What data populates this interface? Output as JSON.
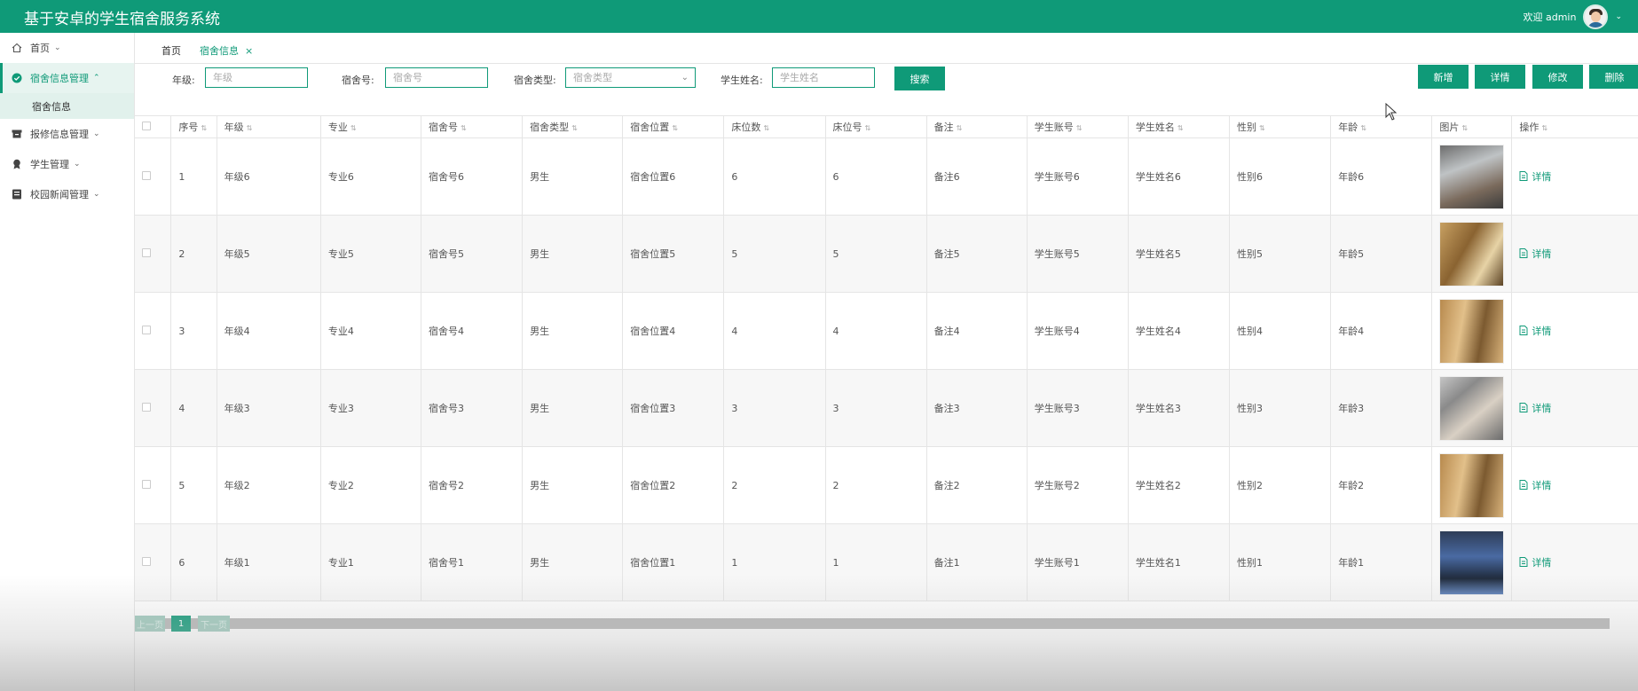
{
  "header": {
    "app_title": "基于安卓的学生宿舍服务系统",
    "welcome": "欢迎 admin",
    "avatar_icon": "user-avatar-icon"
  },
  "sidebar": {
    "items": [
      {
        "label": "首页",
        "icon": "home-icon"
      },
      {
        "label": "宿舍信息管理",
        "icon": "check-circle-icon",
        "active": true
      },
      {
        "label": "报修信息管理",
        "icon": "archive-box-icon"
      },
      {
        "label": "学生管理",
        "icon": "badge-icon"
      },
      {
        "label": "校园新闻管理",
        "icon": "news-icon"
      }
    ],
    "sub_item": "宿舍信息"
  },
  "tabs": {
    "home": "首页",
    "current": "宿舍信息",
    "close": "×"
  },
  "filters": {
    "grade_label": "年级:",
    "grade_placeholder": "年级",
    "room_label": "宿舍号:",
    "room_placeholder": "宿舍号",
    "type_label": "宿舍类型:",
    "type_placeholder": "宿舍类型",
    "name_label": "学生姓名:",
    "name_placeholder": "学生姓名",
    "search_button": "搜索"
  },
  "actions": {
    "add": "新增",
    "detail": "详情",
    "edit": "修改",
    "delete": "删除"
  },
  "table": {
    "columns": [
      "序号",
      "年级",
      "专业",
      "宿舍号",
      "宿舍类型",
      "宿舍位置",
      "床位数",
      "床位号",
      "备注",
      "学生账号",
      "学生姓名",
      "性别",
      "年龄",
      "图片",
      "操作"
    ],
    "rows": [
      {
        "no": "1",
        "grade": "年级6",
        "major": "专业6",
        "room": "宿舍号6",
        "type": "男生",
        "location": "宿舍位置6",
        "beds": "6",
        "bed_no": "6",
        "note": "备注6",
        "account": "学生账号6",
        "name": "学生姓名6",
        "gender": "性别6",
        "age": "年龄6",
        "op": "详情"
      },
      {
        "no": "2",
        "grade": "年级5",
        "major": "专业5",
        "room": "宿舍号5",
        "type": "男生",
        "location": "宿舍位置5",
        "beds": "5",
        "bed_no": "5",
        "note": "备注5",
        "account": "学生账号5",
        "name": "学生姓名5",
        "gender": "性别5",
        "age": "年龄5",
        "op": "详情"
      },
      {
        "no": "3",
        "grade": "年级4",
        "major": "专业4",
        "room": "宿舍号4",
        "type": "男生",
        "location": "宿舍位置4",
        "beds": "4",
        "bed_no": "4",
        "note": "备注4",
        "account": "学生账号4",
        "name": "学生姓名4",
        "gender": "性别4",
        "age": "年龄4",
        "op": "详情"
      },
      {
        "no": "4",
        "grade": "年级3",
        "major": "专业3",
        "room": "宿舍号3",
        "type": "男生",
        "location": "宿舍位置3",
        "beds": "3",
        "bed_no": "3",
        "note": "备注3",
        "account": "学生账号3",
        "name": "学生姓名3",
        "gender": "性别3",
        "age": "年龄3",
        "op": "详情"
      },
      {
        "no": "5",
        "grade": "年级2",
        "major": "专业2",
        "room": "宿舍号2",
        "type": "男生",
        "location": "宿舍位置2",
        "beds": "2",
        "bed_no": "2",
        "note": "备注2",
        "account": "学生账号2",
        "name": "学生姓名2",
        "gender": "性别2",
        "age": "年龄2",
        "op": "详情"
      },
      {
        "no": "6",
        "grade": "年级1",
        "major": "专业1",
        "room": "宿舍号1",
        "type": "男生",
        "location": "宿舍位置1",
        "beds": "1",
        "bed_no": "1",
        "note": "备注1",
        "account": "学生账号1",
        "name": "学生姓名1",
        "gender": "性别1",
        "age": "年龄1",
        "op": "详情"
      }
    ]
  },
  "pagination": {
    "prev": "上一页",
    "current_page": "1",
    "next": "下一页"
  },
  "colors": {
    "primary": "#0f9a78",
    "row_alt": "#f7f7f7"
  }
}
